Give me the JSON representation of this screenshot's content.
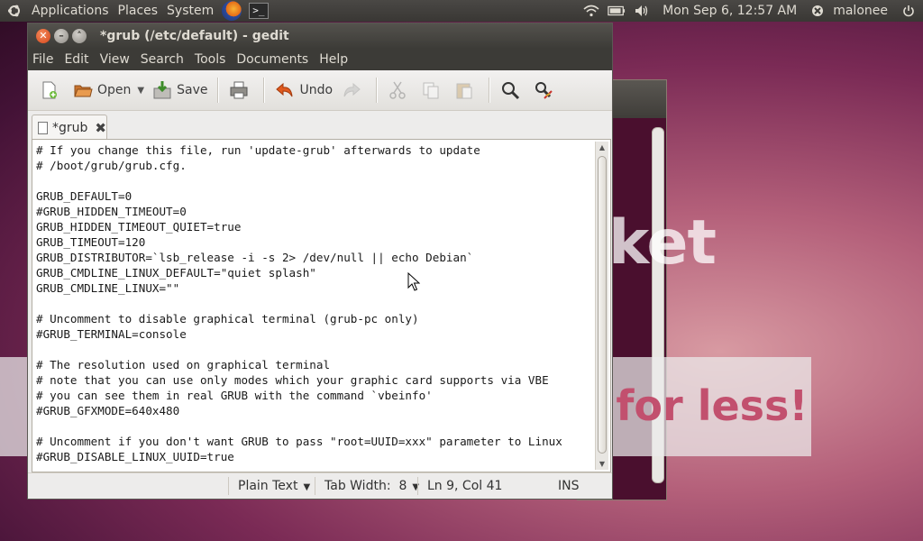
{
  "panel": {
    "menus": [
      "Applications",
      "Places",
      "System"
    ],
    "terminal_glyph": ">_",
    "clock": "Mon Sep  6, 12:57 AM",
    "user": "malonee"
  },
  "background": {
    "window_text": "ket",
    "banner_text": "s for less!"
  },
  "window": {
    "title": "*grub (/etc/default) - gedit",
    "menu": [
      "File",
      "Edit",
      "View",
      "Search",
      "Tools",
      "Documents",
      "Help"
    ],
    "toolbar": {
      "open": "Open",
      "save": "Save",
      "undo": "Undo"
    },
    "tab": {
      "label": "*grub",
      "close": "✖"
    }
  },
  "editor": {
    "lines": [
      "# If you change this file, run 'update-grub' afterwards to update",
      "# /boot/grub/grub.cfg.",
      "",
      "GRUB_DEFAULT=0",
      "#GRUB_HIDDEN_TIMEOUT=0",
      "GRUB_HIDDEN_TIMEOUT_QUIET=true",
      "GRUB_TIMEOUT=120",
      "GRUB_DISTRIBUTOR=`lsb_release -i -s 2> /dev/null || echo Debian`",
      "GRUB_CMDLINE_LINUX_DEFAULT=\"quiet splash\"",
      "GRUB_CMDLINE_LINUX=\"\"",
      "",
      "# Uncomment to disable graphical terminal (grub-pc only)",
      "#GRUB_TERMINAL=console",
      "",
      "# The resolution used on graphical terminal",
      "# note that you can use only modes which your graphic card supports via VBE",
      "# you can see them in real GRUB with the command `vbeinfo'",
      "#GRUB_GFXMODE=640x480",
      "",
      "# Uncomment if you don't want GRUB to pass \"root=UUID=xxx\" parameter to Linux",
      "#GRUB_DISABLE_LINUX_UUID=true"
    ]
  },
  "statusbar": {
    "language": "Plain Text",
    "tab_width": "Tab Width:  8",
    "position": "Ln 9, Col 41",
    "mode": "INS"
  }
}
